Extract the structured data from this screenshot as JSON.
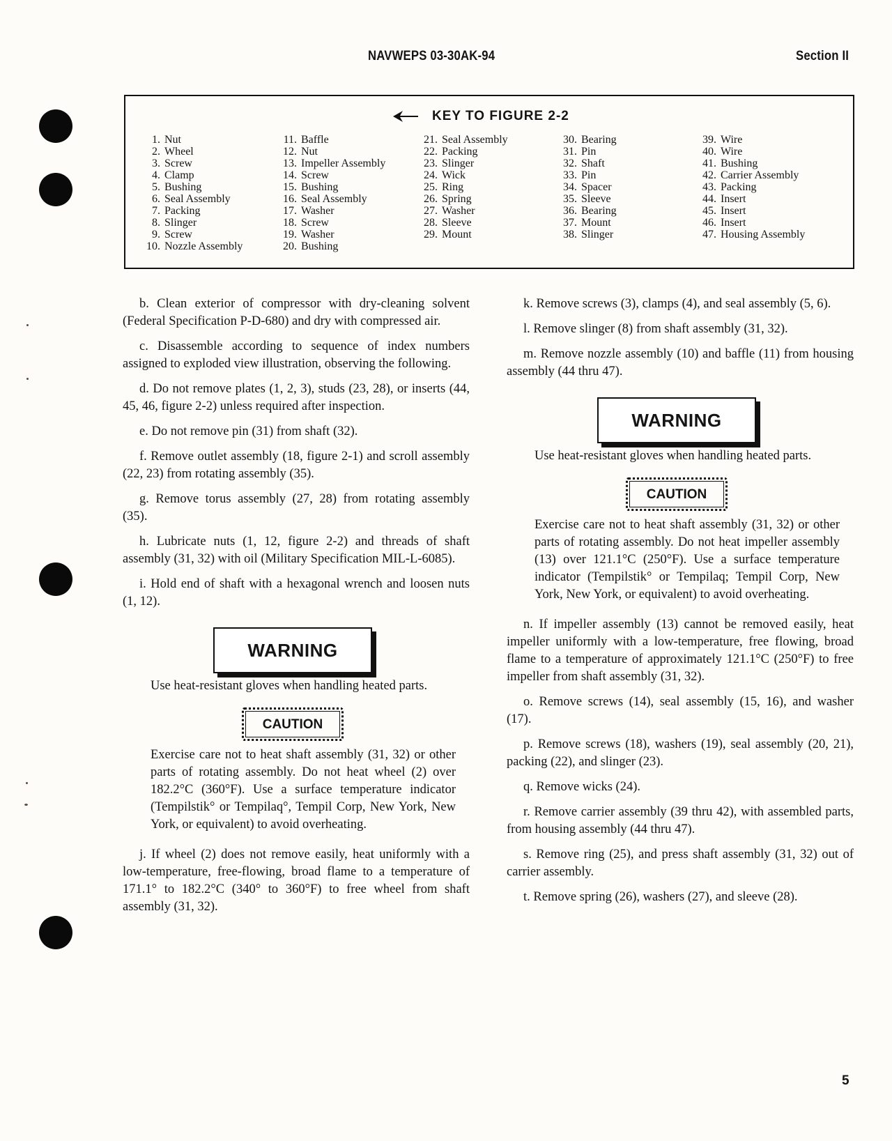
{
  "header": {
    "doc_number": "NAVWEPS 03-30AK-94",
    "section": "Section II"
  },
  "key": {
    "title": "KEY TO FIGURE 2-2",
    "arrow_icon": "left-arrow-icon",
    "columns": [
      [
        {
          "n": "1.",
          "label": "Nut"
        },
        {
          "n": "2.",
          "label": "Wheel"
        },
        {
          "n": "3.",
          "label": "Screw"
        },
        {
          "n": "4.",
          "label": "Clamp"
        },
        {
          "n": "5.",
          "label": "Bushing"
        },
        {
          "n": "6.",
          "label": "Seal Assembly"
        },
        {
          "n": "7.",
          "label": "Packing"
        },
        {
          "n": "8.",
          "label": "Slinger"
        },
        {
          "n": "9.",
          "label": "Screw"
        },
        {
          "n": "10.",
          "label": "Nozzle Assembly"
        }
      ],
      [
        {
          "n": "11.",
          "label": "Baffle"
        },
        {
          "n": "12.",
          "label": "Nut"
        },
        {
          "n": "13.",
          "label": "Impeller Assembly"
        },
        {
          "n": "14.",
          "label": "Screw"
        },
        {
          "n": "15.",
          "label": "Bushing"
        },
        {
          "n": "16.",
          "label": "Seal Assembly"
        },
        {
          "n": "17.",
          "label": "Washer"
        },
        {
          "n": "18.",
          "label": "Screw"
        },
        {
          "n": "19.",
          "label": "Washer"
        },
        {
          "n": "20.",
          "label": "Bushing"
        }
      ],
      [
        {
          "n": "21.",
          "label": "Seal Assembly"
        },
        {
          "n": "22.",
          "label": "Packing"
        },
        {
          "n": "23.",
          "label": "Slinger"
        },
        {
          "n": "24.",
          "label": "Wick"
        },
        {
          "n": "25.",
          "label": "Ring"
        },
        {
          "n": "26.",
          "label": "Spring"
        },
        {
          "n": "27.",
          "label": "Washer"
        },
        {
          "n": "28.",
          "label": "Sleeve"
        },
        {
          "n": "29.",
          "label": "Mount"
        }
      ],
      [
        {
          "n": "30.",
          "label": "Bearing"
        },
        {
          "n": "31.",
          "label": "Pin"
        },
        {
          "n": "32.",
          "label": "Shaft"
        },
        {
          "n": "33.",
          "label": "Pin"
        },
        {
          "n": "34.",
          "label": "Spacer"
        },
        {
          "n": "35.",
          "label": "Sleeve"
        },
        {
          "n": "36.",
          "label": "Bearing"
        },
        {
          "n": "37.",
          "label": "Mount"
        },
        {
          "n": "38.",
          "label": "Slinger"
        }
      ],
      [
        {
          "n": "39.",
          "label": "Wire"
        },
        {
          "n": "40.",
          "label": "Wire"
        },
        {
          "n": "41.",
          "label": "Bushing"
        },
        {
          "n": "42.",
          "label": "Carrier Assembly"
        },
        {
          "n": "43.",
          "label": "Packing"
        },
        {
          "n": "44.",
          "label": "Insert"
        },
        {
          "n": "45.",
          "label": "Insert"
        },
        {
          "n": "46.",
          "label": "Insert"
        },
        {
          "n": "47.",
          "label": "Housing Assembly"
        }
      ]
    ]
  },
  "left_column": {
    "b": "b. Clean exterior of compressor with dry-cleaning solvent (Federal Specification P-D-680) and dry with compressed air.",
    "c": "c. Disassemble according to sequence of index numbers assigned to exploded view illustration, observing the following.",
    "d": "d. Do not remove plates (1, 2, 3), studs (23, 28), or inserts (44, 45, 46, figure 2-2) unless required after inspection.",
    "e": "e. Do not remove pin (31) from shaft (32).",
    "f": "f. Remove outlet assembly (18, figure 2-1) and scroll assembly (22, 23) from rotating assembly (35).",
    "g": "g. Remove torus assembly (27, 28) from rotating assembly (35).",
    "h": "h. Lubricate nuts (1, 12, figure 2-2) and threads of shaft assembly (31, 32) with oil (Military Specification MIL-L-6085).",
    "i": "i. Hold end of shaft with a hexagonal wrench and loosen nuts (1, 12).",
    "warning_label": "WARNING",
    "warning_text": "Use heat-resistant gloves when handling heated parts.",
    "caution_label": "CAUTION",
    "caution_text": "Exercise care not to heat shaft assembly (31, 32) or other parts of rotating assembly. Do not heat wheel (2) over 182.2°C (360°F). Use a surface temperature indicator (Tempilstik° or Tempilaq°, Tempil Corp, New York, New York, or equivalent) to avoid overheating.",
    "j": "j. If wheel (2) does not remove easily, heat uniformly with a low-temperature, free-flowing, broad flame to a temperature of 171.1° to 182.2°C (340° to 360°F) to free wheel from shaft assembly (31, 32)."
  },
  "right_column": {
    "k": "k. Remove screws (3), clamps (4), and seal assembly (5, 6).",
    "l": "l. Remove slinger (8) from shaft assembly (31, 32).",
    "m": "m. Remove nozzle assembly (10) and baffle (11) from housing assembly (44 thru 47).",
    "warning_label": "WARNING",
    "warning_text": "Use heat-resistant gloves when handling heated parts.",
    "caution_label": "CAUTION",
    "caution_text": "Exercise care not to heat shaft assembly (31, 32) or other parts of rotating assembly. Do not heat impeller assembly (13) over 121.1°C (250°F). Use a surface temperature indicator (Tempilstik° or Tempilaq; Tempil Corp, New York, New York, or equivalent) to avoid overheating.",
    "n": "n. If impeller assembly (13) cannot be removed easily, heat impeller uniformly with a low-temperature, free flowing, broad flame to a temperature of approximately 121.1°C (250°F) to free impeller from shaft assembly (31, 32).",
    "o": "o. Remove screws (14), seal assembly (15, 16), and washer (17).",
    "p": "p. Remove screws (18), washers (19), seal assembly (20, 21), packing (22), and slinger (23).",
    "q": "q. Remove wicks (24).",
    "r": "r. Remove carrier assembly (39 thru 42), with assembled parts, from housing assembly (44 thru 47).",
    "s": "s. Remove ring (25), and press shaft assembly (31, 32) out of carrier assembly.",
    "t": "t. Remove spring (26), washers (27), and sleeve (28)."
  },
  "page_number": "5"
}
